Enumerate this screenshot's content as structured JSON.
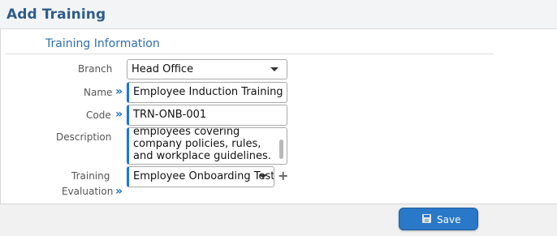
{
  "header": {
    "title": "Add Training"
  },
  "section": {
    "title": "Training Information"
  },
  "form": {
    "branch": {
      "label": "Branch",
      "value": "Head Office"
    },
    "name": {
      "label": "Name",
      "value": "Employee Induction Training"
    },
    "code": {
      "label": "Code",
      "value": "TRN-ONB-001"
    },
    "description": {
      "label": "Description",
      "value": "employees covering company policies, rules, and workplace guidelines."
    },
    "evaluation": {
      "label_line1": "Training",
      "label_line2": "Evaluation",
      "value": "Employee Onboarding Test"
    },
    "required_marker": "»",
    "add_symbol": "+"
  },
  "footer": {
    "save_label": "Save"
  },
  "icons": {
    "required_arrow": "double-chevron-right-icon",
    "select_caret": "caret-down-icon",
    "add": "plus-icon",
    "save": "floppy-disk-icon"
  },
  "colors": {
    "accent": "#2a78c8",
    "title": "#2d5d8b",
    "required": "#1a73e8"
  }
}
